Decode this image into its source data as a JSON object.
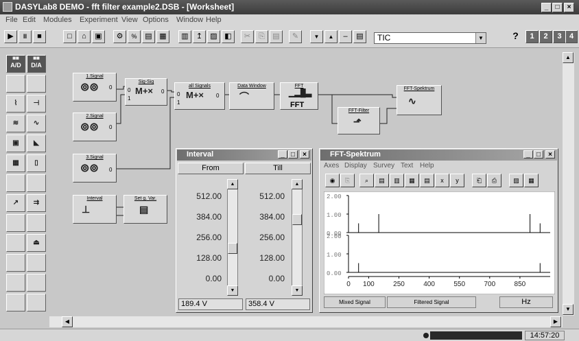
{
  "window": {
    "title": "DASYLab8 DEMO - fft filter example2.DSB - [Worksheet]"
  },
  "menu": [
    "File",
    "Edit",
    "Modules",
    "Experiment",
    "View",
    "Options",
    "Window",
    "Help"
  ],
  "toolbar": {
    "play": "▶",
    "pause": "II",
    "stop": "■",
    "select_value": "TIC",
    "help": "?",
    "nums": [
      "1",
      "2",
      "3",
      "4"
    ]
  },
  "palette": {
    "ad": "A/D",
    "da": "D/A"
  },
  "modules": {
    "sig1": "1.Signal",
    "sig2": "2.Signal",
    "sig3": "3.Signal",
    "sigsig": "Sig-Sig",
    "allsig": "all Signals",
    "datawin": "Data Window",
    "fft": "FFT",
    "fftfilter": "FFT-Filter",
    "fftspek": "FFT-Spektrum",
    "interval": "Interval",
    "setvar": "Set g. Var.",
    "fft_icon_text": "FFT"
  },
  "interval_window": {
    "title": "Interval",
    "col_from": "From",
    "col_till": "Till",
    "scale": [
      "512.00",
      "384.00",
      "256.00",
      "128.00",
      "0.00"
    ],
    "from_value": "189.4 V",
    "till_value": "358.4 V"
  },
  "fft_window": {
    "title": "FFT-Spektrum",
    "menu": [
      "Axes",
      "Display",
      "Survey",
      "Text",
      "Help"
    ],
    "legend_mixed": "Mixed Signal",
    "legend_filtered": "Filtered Signal",
    "unit": "Hz"
  },
  "chart_data": [
    {
      "type": "line",
      "series": [
        {
          "name": "Mixed Signal",
          "x": [
            0,
            50,
            100,
            150,
            200,
            900,
            950,
            1000
          ],
          "values": [
            0.0,
            0.5,
            0.0,
            1.0,
            0.0,
            1.0,
            0.5,
            0.0
          ]
        }
      ],
      "ylim": [
        0,
        2
      ],
      "yticks": [
        "2.00",
        "1.00",
        "0.00"
      ]
    },
    {
      "type": "line",
      "series": [
        {
          "name": "Filtered Signal",
          "x": [
            0,
            50,
            100,
            950,
            1000
          ],
          "values": [
            0.0,
            0.5,
            0.0,
            0.5,
            0.0
          ]
        }
      ],
      "ylim": [
        0,
        2
      ],
      "yticks": [
        "2.00",
        "1.00",
        "0.00"
      ],
      "xticks": [
        "0",
        "100",
        "250",
        "400",
        "550",
        "700",
        "850"
      ]
    }
  ],
  "status": {
    "time": "14:57:20"
  }
}
